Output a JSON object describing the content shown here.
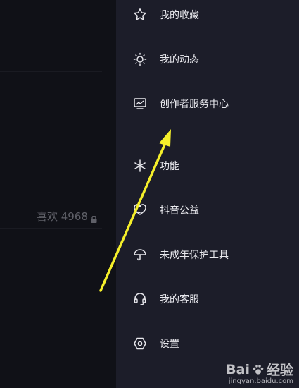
{
  "profile": {
    "likes_label": "喜欢 4968"
  },
  "drawer": {
    "items": [
      {
        "label": "我的收藏",
        "icon": "star-icon"
      },
      {
        "label": "我的动态",
        "icon": "sun-icon"
      },
      {
        "label": "创作者服务中心",
        "icon": "monitor-chart-icon"
      },
      {
        "label": "功能",
        "icon": "asterisk-icon"
      },
      {
        "label": "抖音公益",
        "icon": "heart-hand-icon"
      },
      {
        "label": "未成年保护工具",
        "icon": "umbrella-icon"
      },
      {
        "label": "我的客服",
        "icon": "headset-icon"
      },
      {
        "label": "设置",
        "icon": "hexagon-settings-icon"
      }
    ]
  },
  "watermark": {
    "brand": "Bai",
    "brand_cn": "经验",
    "url": "jingyan.baidu.com"
  },
  "colors": {
    "drawer_bg": "#1c1d29",
    "arrow": "#f5ef2a"
  }
}
